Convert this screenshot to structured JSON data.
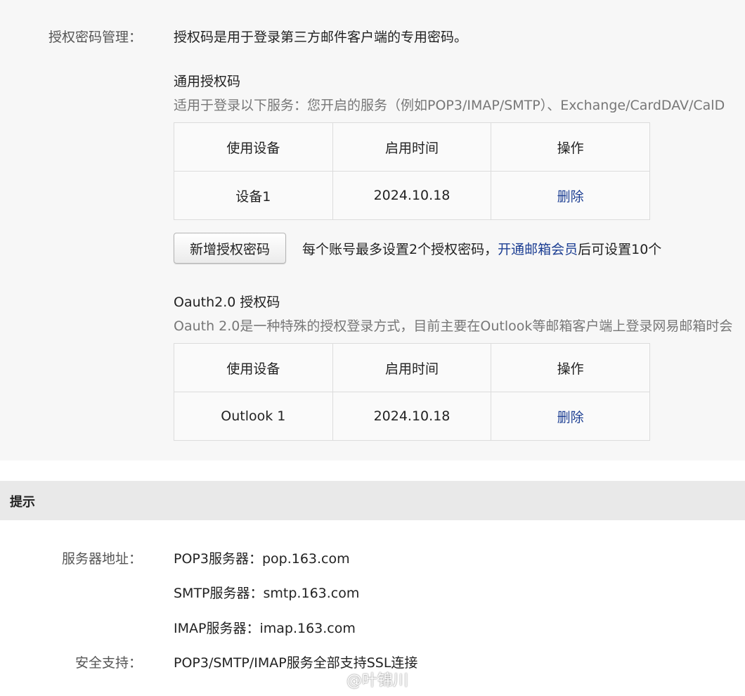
{
  "auth": {
    "label": "授权密码管理：",
    "intro": "授权码是用于登录第三方邮件客户端的专用密码。",
    "general": {
      "title": "通用授权码",
      "desc": "适用于登录以下服务：您开启的服务（例如POP3/IMAP/SMTP）、Exchange/CardDAV/CalD",
      "columns": [
        "使用设备",
        "启用时间",
        "操作"
      ],
      "rows": [
        {
          "device": "设备1",
          "time": "2024.10.18",
          "action": "删除"
        }
      ]
    },
    "add_button": "新增授权密码",
    "limit": {
      "prefix": "每个账号最多设置2个授权密码，",
      "link": "开通邮箱会员",
      "suffix": "后可设置10个"
    },
    "oauth": {
      "title": "Oauth2.0 授权码",
      "desc": "Oauth 2.0是一种特殊的授权登录方式，目前主要在Outlook等邮箱客户端上登录网易邮箱时会",
      "columns": [
        "使用设备",
        "启用时间",
        "操作"
      ],
      "rows": [
        {
          "device": "Outlook 1",
          "time": "2024.10.18",
          "action": "删除"
        }
      ]
    }
  },
  "tips": {
    "title": "提示",
    "server_label": "服务器地址：",
    "servers": [
      "POP3服务器：pop.163.com",
      "SMTP服务器：smtp.163.com",
      "IMAP服务器：imap.163.com"
    ],
    "security_label": "安全支持：",
    "security_value": "POP3/SMTP/IMAP服务全部支持SSL连接"
  },
  "watermark": {
    "text": "@叶锦川",
    "icon": "weibo-icon"
  },
  "colors": {
    "link": "#1d3f93",
    "tip_bar": "#e9e9e9",
    "background": "#f7f7f7"
  }
}
